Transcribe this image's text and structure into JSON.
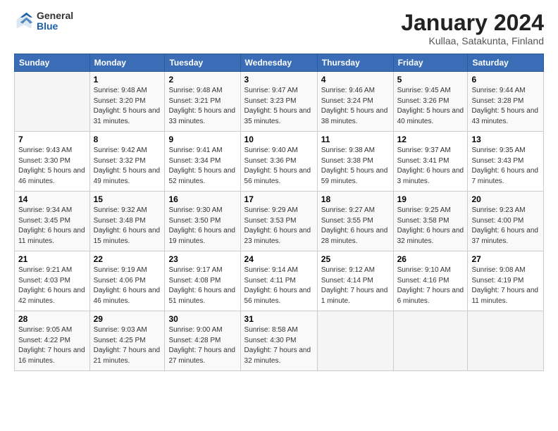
{
  "header": {
    "logo_general": "General",
    "logo_blue": "Blue",
    "month_title": "January 2024",
    "subtitle": "Kullaa, Satakunta, Finland"
  },
  "days_of_week": [
    "Sunday",
    "Monday",
    "Tuesday",
    "Wednesday",
    "Thursday",
    "Friday",
    "Saturday"
  ],
  "weeks": [
    [
      {
        "num": "",
        "sunrise": "",
        "sunset": "",
        "daylight": ""
      },
      {
        "num": "1",
        "sunrise": "Sunrise: 9:48 AM",
        "sunset": "Sunset: 3:20 PM",
        "daylight": "Daylight: 5 hours and 31 minutes."
      },
      {
        "num": "2",
        "sunrise": "Sunrise: 9:48 AM",
        "sunset": "Sunset: 3:21 PM",
        "daylight": "Daylight: 5 hours and 33 minutes."
      },
      {
        "num": "3",
        "sunrise": "Sunrise: 9:47 AM",
        "sunset": "Sunset: 3:23 PM",
        "daylight": "Daylight: 5 hours and 35 minutes."
      },
      {
        "num": "4",
        "sunrise": "Sunrise: 9:46 AM",
        "sunset": "Sunset: 3:24 PM",
        "daylight": "Daylight: 5 hours and 38 minutes."
      },
      {
        "num": "5",
        "sunrise": "Sunrise: 9:45 AM",
        "sunset": "Sunset: 3:26 PM",
        "daylight": "Daylight: 5 hours and 40 minutes."
      },
      {
        "num": "6",
        "sunrise": "Sunrise: 9:44 AM",
        "sunset": "Sunset: 3:28 PM",
        "daylight": "Daylight: 5 hours and 43 minutes."
      }
    ],
    [
      {
        "num": "7",
        "sunrise": "Sunrise: 9:43 AM",
        "sunset": "Sunset: 3:30 PM",
        "daylight": "Daylight: 5 hours and 46 minutes."
      },
      {
        "num": "8",
        "sunrise": "Sunrise: 9:42 AM",
        "sunset": "Sunset: 3:32 PM",
        "daylight": "Daylight: 5 hours and 49 minutes."
      },
      {
        "num": "9",
        "sunrise": "Sunrise: 9:41 AM",
        "sunset": "Sunset: 3:34 PM",
        "daylight": "Daylight: 5 hours and 52 minutes."
      },
      {
        "num": "10",
        "sunrise": "Sunrise: 9:40 AM",
        "sunset": "Sunset: 3:36 PM",
        "daylight": "Daylight: 5 hours and 56 minutes."
      },
      {
        "num": "11",
        "sunrise": "Sunrise: 9:38 AM",
        "sunset": "Sunset: 3:38 PM",
        "daylight": "Daylight: 5 hours and 59 minutes."
      },
      {
        "num": "12",
        "sunrise": "Sunrise: 9:37 AM",
        "sunset": "Sunset: 3:41 PM",
        "daylight": "Daylight: 6 hours and 3 minutes."
      },
      {
        "num": "13",
        "sunrise": "Sunrise: 9:35 AM",
        "sunset": "Sunset: 3:43 PM",
        "daylight": "Daylight: 6 hours and 7 minutes."
      }
    ],
    [
      {
        "num": "14",
        "sunrise": "Sunrise: 9:34 AM",
        "sunset": "Sunset: 3:45 PM",
        "daylight": "Daylight: 6 hours and 11 minutes."
      },
      {
        "num": "15",
        "sunrise": "Sunrise: 9:32 AM",
        "sunset": "Sunset: 3:48 PM",
        "daylight": "Daylight: 6 hours and 15 minutes."
      },
      {
        "num": "16",
        "sunrise": "Sunrise: 9:30 AM",
        "sunset": "Sunset: 3:50 PM",
        "daylight": "Daylight: 6 hours and 19 minutes."
      },
      {
        "num": "17",
        "sunrise": "Sunrise: 9:29 AM",
        "sunset": "Sunset: 3:53 PM",
        "daylight": "Daylight: 6 hours and 23 minutes."
      },
      {
        "num": "18",
        "sunrise": "Sunrise: 9:27 AM",
        "sunset": "Sunset: 3:55 PM",
        "daylight": "Daylight: 6 hours and 28 minutes."
      },
      {
        "num": "19",
        "sunrise": "Sunrise: 9:25 AM",
        "sunset": "Sunset: 3:58 PM",
        "daylight": "Daylight: 6 hours and 32 minutes."
      },
      {
        "num": "20",
        "sunrise": "Sunrise: 9:23 AM",
        "sunset": "Sunset: 4:00 PM",
        "daylight": "Daylight: 6 hours and 37 minutes."
      }
    ],
    [
      {
        "num": "21",
        "sunrise": "Sunrise: 9:21 AM",
        "sunset": "Sunset: 4:03 PM",
        "daylight": "Daylight: 6 hours and 42 minutes."
      },
      {
        "num": "22",
        "sunrise": "Sunrise: 9:19 AM",
        "sunset": "Sunset: 4:06 PM",
        "daylight": "Daylight: 6 hours and 46 minutes."
      },
      {
        "num": "23",
        "sunrise": "Sunrise: 9:17 AM",
        "sunset": "Sunset: 4:08 PM",
        "daylight": "Daylight: 6 hours and 51 minutes."
      },
      {
        "num": "24",
        "sunrise": "Sunrise: 9:14 AM",
        "sunset": "Sunset: 4:11 PM",
        "daylight": "Daylight: 6 hours and 56 minutes."
      },
      {
        "num": "25",
        "sunrise": "Sunrise: 9:12 AM",
        "sunset": "Sunset: 4:14 PM",
        "daylight": "Daylight: 7 hours and 1 minute."
      },
      {
        "num": "26",
        "sunrise": "Sunrise: 9:10 AM",
        "sunset": "Sunset: 4:16 PM",
        "daylight": "Daylight: 7 hours and 6 minutes."
      },
      {
        "num": "27",
        "sunrise": "Sunrise: 9:08 AM",
        "sunset": "Sunset: 4:19 PM",
        "daylight": "Daylight: 7 hours and 11 minutes."
      }
    ],
    [
      {
        "num": "28",
        "sunrise": "Sunrise: 9:05 AM",
        "sunset": "Sunset: 4:22 PM",
        "daylight": "Daylight: 7 hours and 16 minutes."
      },
      {
        "num": "29",
        "sunrise": "Sunrise: 9:03 AM",
        "sunset": "Sunset: 4:25 PM",
        "daylight": "Daylight: 7 hours and 21 minutes."
      },
      {
        "num": "30",
        "sunrise": "Sunrise: 9:00 AM",
        "sunset": "Sunset: 4:28 PM",
        "daylight": "Daylight: 7 hours and 27 minutes."
      },
      {
        "num": "31",
        "sunrise": "Sunrise: 8:58 AM",
        "sunset": "Sunset: 4:30 PM",
        "daylight": "Daylight: 7 hours and 32 minutes."
      },
      {
        "num": "",
        "sunrise": "",
        "sunset": "",
        "daylight": ""
      },
      {
        "num": "",
        "sunrise": "",
        "sunset": "",
        "daylight": ""
      },
      {
        "num": "",
        "sunrise": "",
        "sunset": "",
        "daylight": ""
      }
    ]
  ]
}
